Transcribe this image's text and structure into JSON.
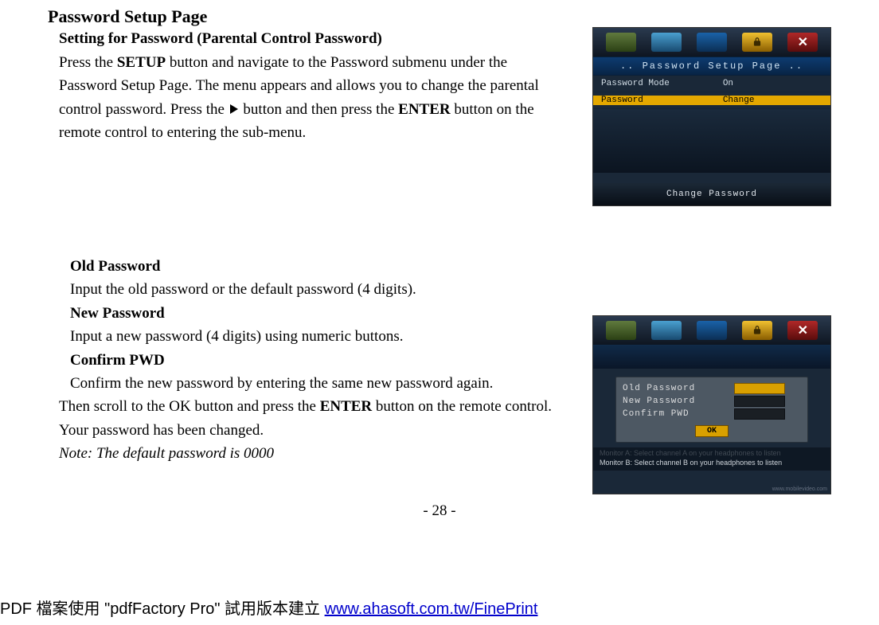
{
  "page": {
    "title": "Password Setup Page",
    "subtitle": "Setting for Password (Parental Control Password)",
    "intro_parts": {
      "p1": "Press the ",
      "p2_bold": "SETUP",
      "p3": " button and navigate to the Password submenu under the Password Setup Page. The menu appears and allows you to change the parental control password. Press the ",
      "p4": " button and then press the ",
      "p5_bold": "ENTER",
      "p6": " button on the remote control to entering the sub-menu."
    },
    "section2": {
      "old_h": "Old Password",
      "old_t": "Input the old password or the default password (4 digits).",
      "new_h": "New Password",
      "new_t": "Input a new password (4 digits) using numeric buttons.",
      "conf_h": "Confirm PWD",
      "conf_t": "Confirm the new password by entering the same new password again.",
      "tail_1": "Then scroll to the OK button and press the ",
      "tail_bold": "ENTER",
      "tail_2": " button on the remote control. Your password has been changed.",
      "note": "Note: The default password is 0000"
    },
    "page_number": "- 28 -"
  },
  "figure1": {
    "band": ".. Password Setup Page ..",
    "row1_l": "Password Mode",
    "row1_r": "On",
    "row2_l": "Password",
    "row2_r": "Change",
    "bottom": "Change  Password"
  },
  "figure2": {
    "pw_old": "Old  Password",
    "pw_new": "New  Password",
    "pw_conf": "Confirm  PWD",
    "ok": "OK",
    "mon_a": "Monitor A: Select channel A on your headphones to listen",
    "mon_b": "Monitor B: Select channel B on your headphones to listen",
    "wm": "www.mobilevideo.com"
  },
  "footer": {
    "pre": "PDF 檔案使用 \"pdfFactory Pro\" 試用版本建立 ",
    "link_text": "www.ahasoft.com.tw/FinePrint"
  },
  "icons": {
    "close": "✕"
  }
}
